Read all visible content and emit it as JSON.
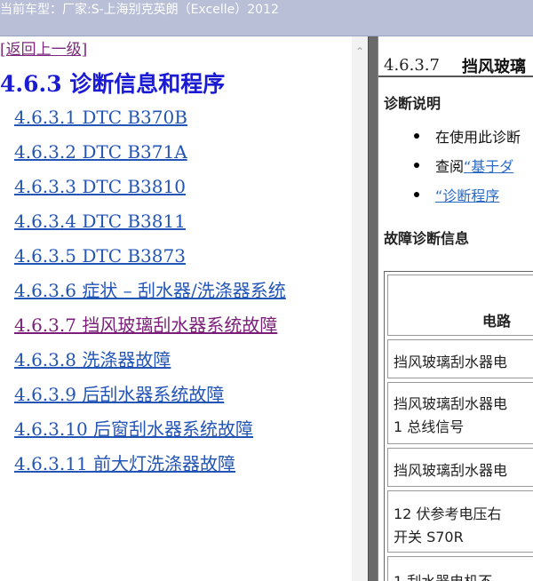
{
  "window": {
    "title": "当前车型：厂家:S-上海别克英朗（Excelle）2012"
  },
  "nav": {
    "back_label": "[返回上一级]",
    "heading": "4.6.3 诊断信息和程序",
    "items": [
      {
        "label": "4.6.3.1 DTC B370B"
      },
      {
        "label": "4.6.3.2 DTC B371A"
      },
      {
        "label": "4.6.3.3 DTC B3810"
      },
      {
        "label": "4.6.3.4 DTC B3811"
      },
      {
        "label": "4.6.3.5 DTC B3873"
      },
      {
        "label": "4.6.3.6 症状 – 刮水器/洗涤器系统"
      },
      {
        "label": "4.6.3.7 挡风玻璃刮水器系统故障"
      },
      {
        "label": "4.6.3.8 洗涤器故障"
      },
      {
        "label": "4.6.3.9 后刮水器系统故障"
      },
      {
        "label": "4.6.3.10 后窗刮水器系统故障"
      },
      {
        "label": "4.6.3.11 前大灯洗涤器故障"
      }
    ]
  },
  "content": {
    "section_number": "4.6.3.7",
    "section_title": "挡风玻璃",
    "diag_desc_heading": "诊断说明",
    "bullet_1": "在使用此诊断",
    "bullet_2_prefix": "查阅",
    "bullet_2_link": "“基于ダ",
    "bullet_3_link": "“诊断程序",
    "fault_info_heading": "故障诊断信息",
    "table": {
      "header": "电路",
      "row_1": "挡风玻璃刮水器电",
      "row_2_line_1": "挡风玻璃刮水器电",
      "row_2_line_2": "1 总线信号",
      "row_3": "挡风玻璃刮水器电",
      "row_4_line_1": "12 伏参考电压右",
      "row_4_line_2": "开关 S70R",
      "row_5": "1 刮水器电机不"
    }
  }
}
